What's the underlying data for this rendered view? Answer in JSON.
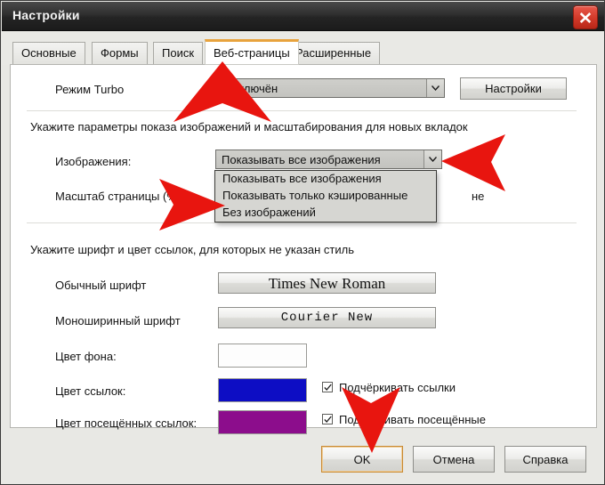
{
  "window": {
    "title": "Настройки",
    "close_icon": "close-icon"
  },
  "tabs": [
    {
      "label": "Основные",
      "active": false
    },
    {
      "label": "Формы",
      "active": false
    },
    {
      "label": "Поиск",
      "active": false
    },
    {
      "label": "Веб-страницы",
      "active": true
    },
    {
      "label": "Расширенные",
      "active": false
    }
  ],
  "turbo": {
    "label": "Режим Turbo",
    "value": "Отключён",
    "settings_button": "Настройки"
  },
  "images_section": {
    "heading": "Укажите параметры показа изображений и масштабирования для новых вкладок",
    "images_label": "Изображения:",
    "images_value": "Показывать все изображения",
    "dropdown_options": [
      "Показывать все изображения",
      "Показывать только кэшированные",
      "Без изображений"
    ],
    "zoom_label": "Масштаб страницы (%):",
    "zoom_trailing_text": "не"
  },
  "fonts_section": {
    "heading": "Укажите шрифт и цвет ссылок, для которых не указан стиль",
    "normal_font_label": "Обычный шрифт",
    "normal_font_value": "Times New Roman",
    "mono_font_label": "Моноширинный шрифт",
    "mono_font_value": "Courier New"
  },
  "colors_section": {
    "background_label": "Цвет фона:",
    "background_color": "#fdfdfd",
    "links_label": "Цвет ссылок:",
    "links_color": "#0d0dc4",
    "visited_label": "Цвет посещённых ссылок:",
    "visited_color": "#8c0d8c",
    "underline_links_label": "Подчёркивать ссылки",
    "underline_links_checked": true,
    "underline_visited_label": "Подчёркивать посещённые",
    "underline_visited_checked": true
  },
  "footer": {
    "ok": "OK",
    "cancel": "Отмена",
    "help": "Справка"
  },
  "annotations": {
    "arrow_color": "#e8150f",
    "arrows": [
      {
        "name": "arrow-up-to-active-tab",
        "direction": "up"
      },
      {
        "name": "arrow-left-to-images-combobox",
        "direction": "left"
      },
      {
        "name": "arrow-right-to-no-images-option",
        "direction": "right"
      },
      {
        "name": "arrow-down-to-ok-button",
        "direction": "down"
      }
    ]
  }
}
